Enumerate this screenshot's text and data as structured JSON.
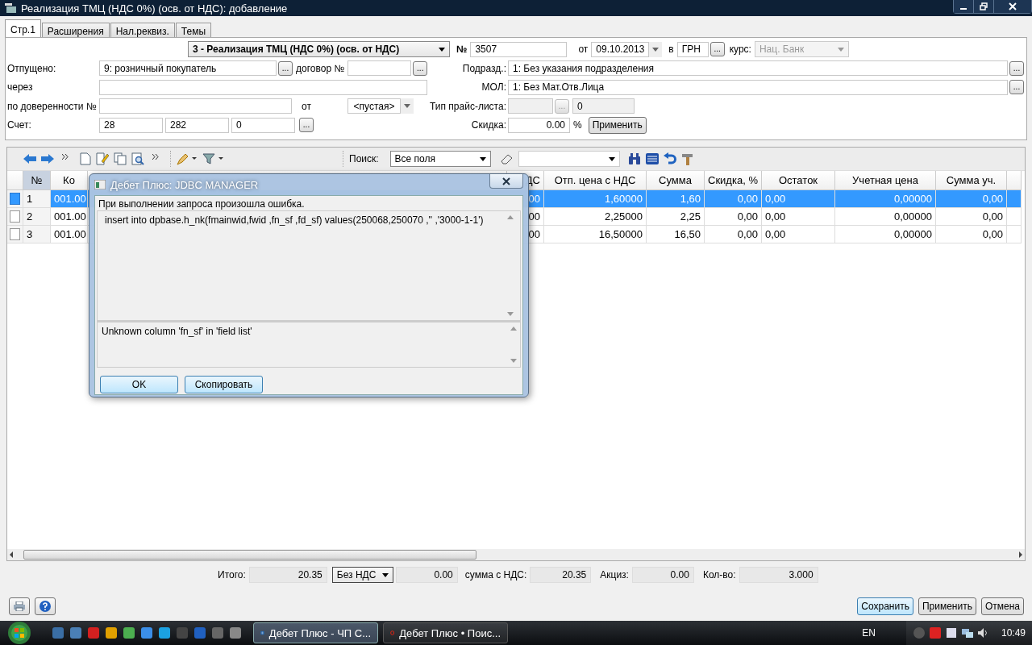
{
  "window": {
    "title": "Реализация ТМЦ (НДС 0%) (осв. от НДС): добавление"
  },
  "tabs": [
    {
      "label": "Стр.1",
      "selected": true
    },
    {
      "label": "Расширения",
      "selected": false
    },
    {
      "label": "Нал.реквиз.",
      "selected": false
    },
    {
      "label": "Темы",
      "selected": false
    }
  ],
  "header": {
    "doc_type": "3 - Реализация ТМЦ (НДС 0%) (осв. от НДС)",
    "number_label": "№",
    "number": "3507",
    "date_label": "от",
    "date": "09.10.2013",
    "currency_label": "в",
    "currency": "ГРН",
    "currency_browse": "...",
    "rate_label": "курс:",
    "rate": "Нац. Банк",
    "rate_disabled": true
  },
  "left": {
    "released_label": "Отпущено:",
    "released": "9: розничный покупатель",
    "released_browse": "...",
    "contract_label": "договор №",
    "contract_browse": "...",
    "via_label": "через",
    "proxy_label": "по доверенности №",
    "proxy_date_label": "от",
    "proxy_date": "<пустая>",
    "account_label": "Счет:",
    "account": [
      "28",
      "282",
      "0"
    ],
    "account_browse": "..."
  },
  "right": {
    "dept_label": "Подразд.:",
    "dept": "1: Без указания подразделения",
    "dept_browse": "...",
    "mol_label": "МОЛ:",
    "mol": "1: Без Мат.Отв.Лица",
    "mol_browse": "...",
    "price_list_label": "Тип прайс-листа:",
    "price_list_browse": "...",
    "price_list_code": "0",
    "discount_label": "Скидка:",
    "discount": "0.00",
    "percent": "%",
    "apply": "Применить"
  },
  "toolbar": {
    "search_label": "Поиск:",
    "search_scope": "Все поля"
  },
  "table": {
    "columns": [
      "№",
      "Ко",
      "ДС",
      "Отп. цена с НДС",
      "Сумма",
      "Скидка, %",
      "Остаток",
      "Учетная цена",
      "Сумма уч."
    ],
    "rows": [
      {
        "selected": true,
        "cells": [
          "1",
          "001.00",
          "00",
          "1,60000",
          "1,60",
          "0,00",
          "0,00",
          "0,00000",
          "0,00"
        ]
      },
      {
        "selected": false,
        "cells": [
          "2",
          "001.00",
          "00",
          "2,25000",
          "2,25",
          "0,00",
          "0,00",
          "0,00000",
          "0,00"
        ]
      },
      {
        "selected": false,
        "cells": [
          "3",
          "001.00",
          "00",
          "16,50000",
          "16,50",
          "0,00",
          "0,00",
          "0,00000",
          "0,00"
        ]
      }
    ]
  },
  "totals": {
    "total_label": "Итого:",
    "total": "20.35",
    "vat_mode": "Без НДС",
    "vat": "0.00",
    "with_vat_label": "сумма с НДС:",
    "with_vat": "20.35",
    "excise_label": "Акциз:",
    "excise": "0.00",
    "qty_label": "Кол-во:",
    "qty": "3.000"
  },
  "buttons": {
    "save": "Сохранить",
    "apply": "Применить",
    "cancel": "Отмена"
  },
  "dialog": {
    "title": "Дебет Плюс: JDBC MANAGER",
    "message": "При выполнении запроса произошла ошибка.",
    "query": "insert into dpbase.h_nk(fmainwid,fwid ,fn_sf ,fd_sf) values(250068,250070 ,'' ,'3000-1-1')",
    "error": "Unknown column 'fn_sf' in 'field list'",
    "ok": "OK",
    "copy": "Скопировать"
  },
  "taskbar": {
    "tasks": [
      {
        "label": "Дебет Плюс - ЧП С...",
        "selected": true
      },
      {
        "label": "Дебет Плюс • Поис...",
        "selected": false
      }
    ],
    "language": "EN",
    "clock": "10:49"
  }
}
